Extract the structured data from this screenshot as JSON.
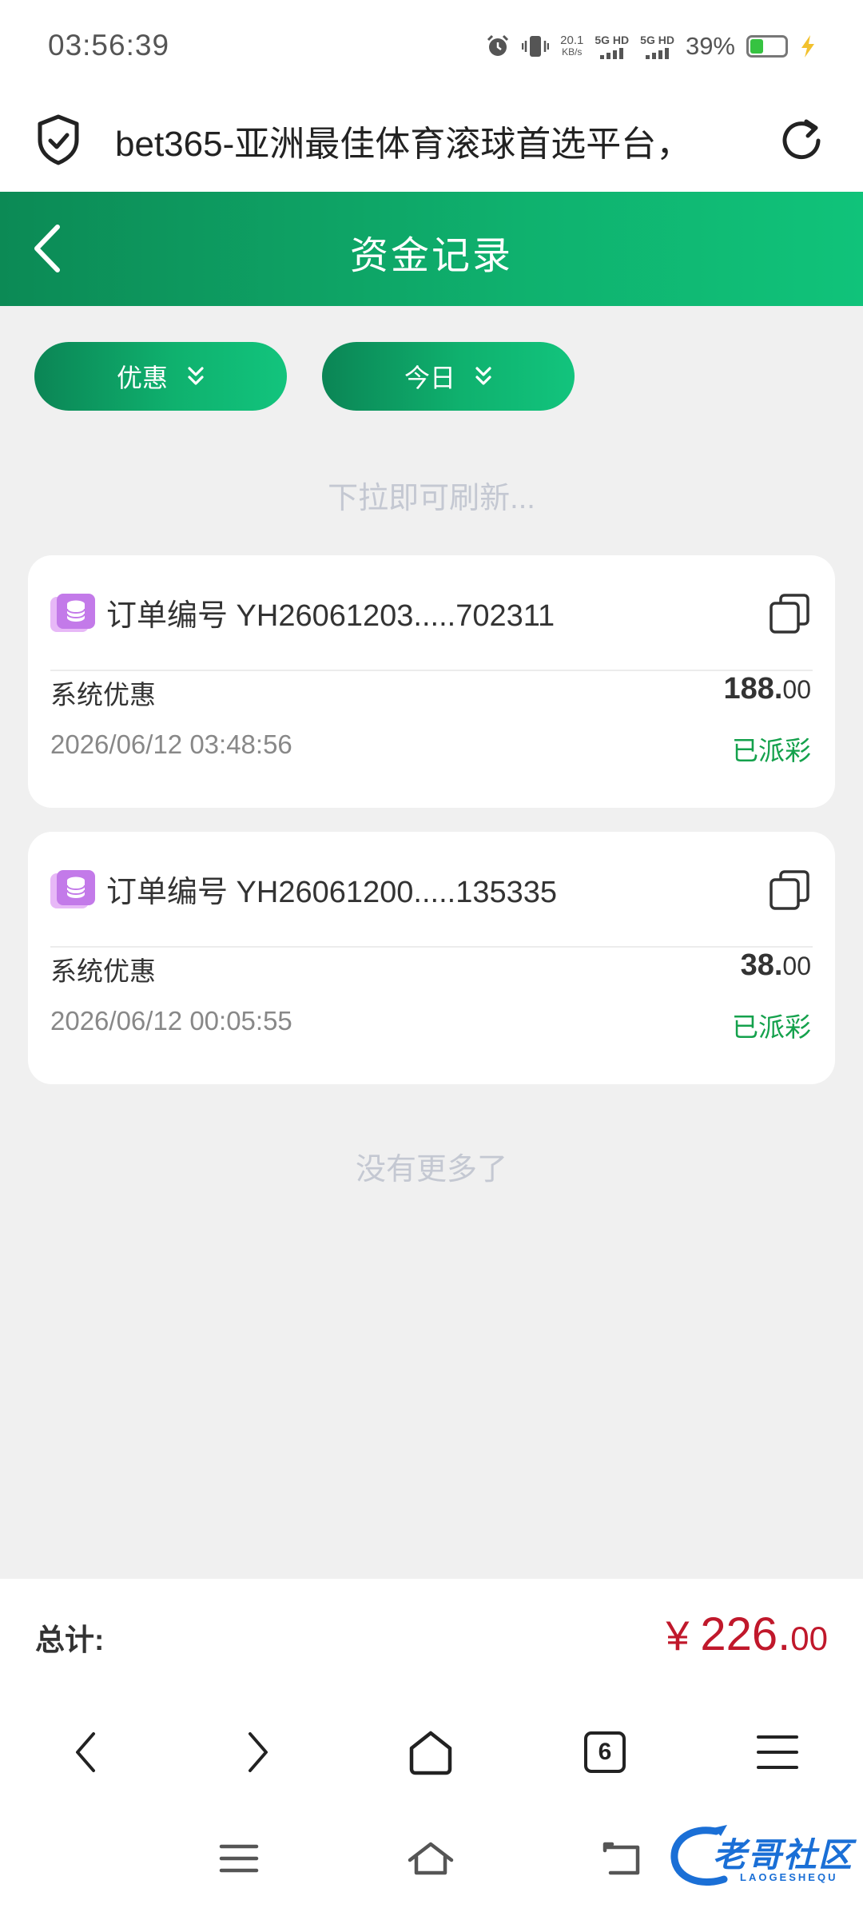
{
  "status_bar": {
    "time": "03:56:39",
    "net_speed_value": "20.1",
    "net_speed_unit": "KB/s",
    "sim1_label": "5G HD",
    "sim2_label": "5G HD",
    "battery_percent": "39%",
    "battery_level": 0.39
  },
  "browser": {
    "page_title": "bet365-亚洲最佳体育滚球首选平台，",
    "tab_count": "6"
  },
  "header": {
    "title": "资金记录"
  },
  "filters": [
    {
      "label": "优惠"
    },
    {
      "label": "今日"
    }
  ],
  "pull_hint": "下拉即可刷新...",
  "records": [
    {
      "order_label": "订单编号 YH26061203.....702311",
      "type": "系统优惠",
      "amount_int": "188.",
      "amount_dec": "00",
      "datetime": "2026/06/12 03:48:56",
      "status": "已派彩"
    },
    {
      "order_label": "订单编号 YH26061200.....135335",
      "type": "系统优惠",
      "amount_int": "38.",
      "amount_dec": "00",
      "datetime": "2026/06/12 00:05:55",
      "status": "已派彩"
    }
  ],
  "no_more_text": "没有更多了",
  "total": {
    "label": "总计:",
    "currency": "¥",
    "amount_int": "226.",
    "amount_dec": "00"
  },
  "watermark": {
    "text": "老哥社区",
    "sub": "LAOGESHEQU"
  },
  "colors": {
    "accent_green": "#0fb16e",
    "status_green": "#14a14c",
    "total_red": "#c0182b"
  }
}
